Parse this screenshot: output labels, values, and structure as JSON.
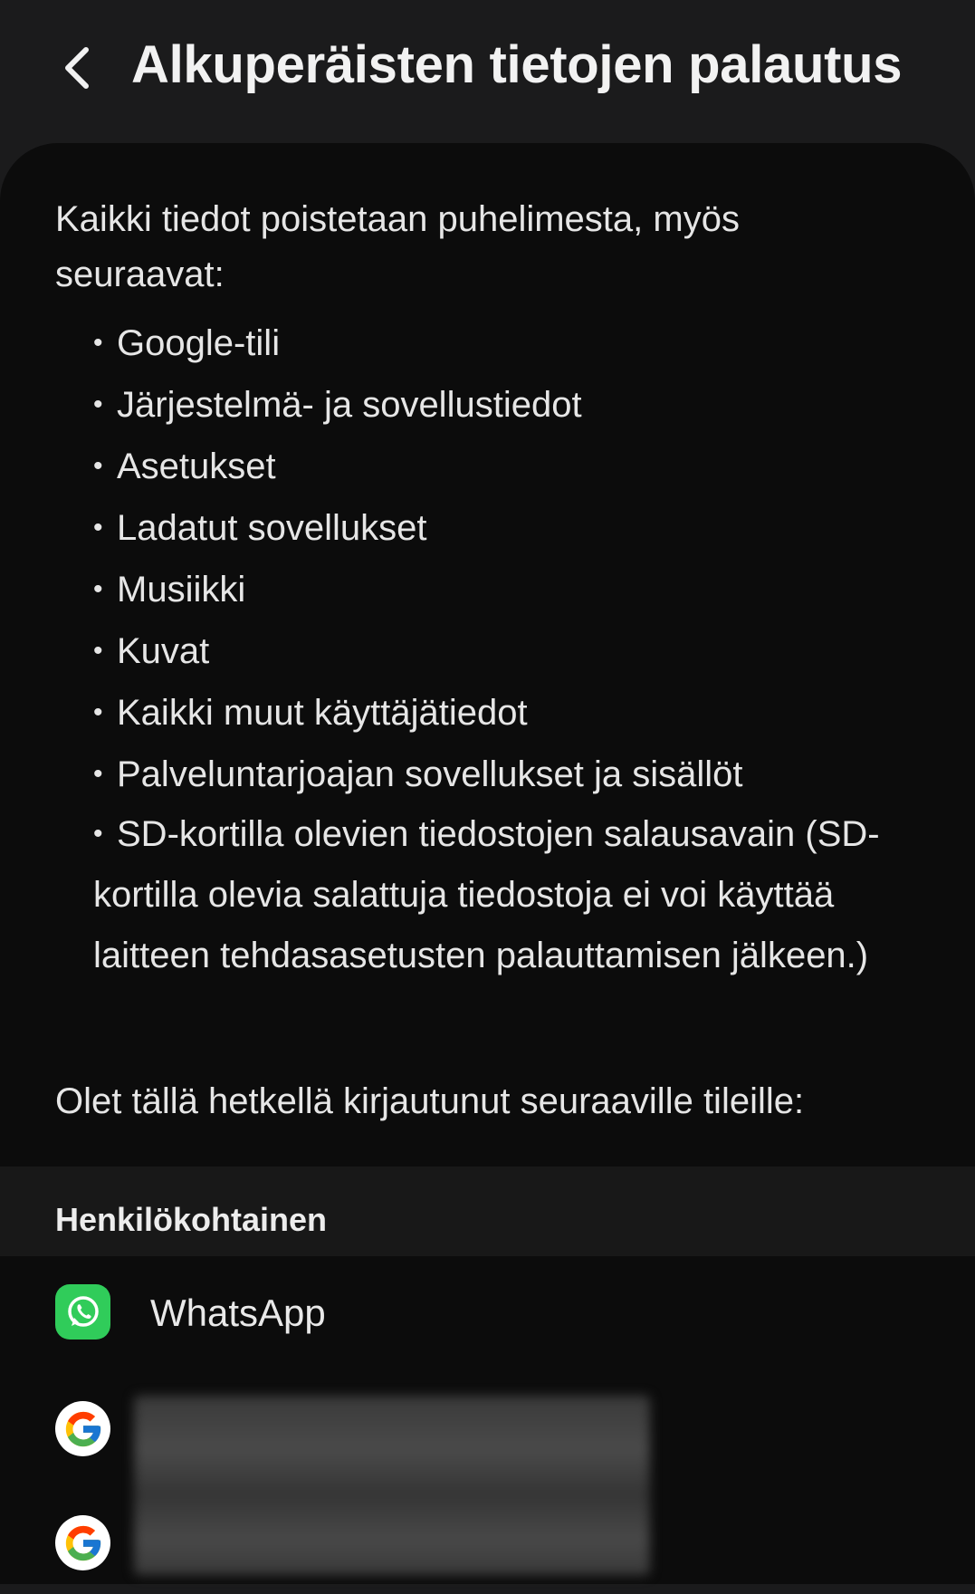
{
  "header": {
    "title": "Alkuperäisten tietojen palautus",
    "back_icon": "chevron-left-icon"
  },
  "content": {
    "intro": "Kaikki tiedot poistetaan puhelimesta, myös seuraavat:",
    "bullet_symbol": "•",
    "items": [
      "Google-tili",
      "Järjestelmä- ja sovellustiedot",
      "Asetukset",
      "Ladatut sovellukset",
      "Musiikki",
      "Kuvat",
      "Kaikki muut käyttäjätiedot",
      "Palveluntarjoajan sovellukset ja sisällöt",
      "SD-kortilla olevien tiedostojen salausavain (SD-kortilla olevia salattuja tiedostoja ei voi käyttää laitteen tehdasasetusten palauttamisen jälkeen.)"
    ],
    "signed_in_text": "Olet tällä hetkellä kirjautunut seuraaville tileille:"
  },
  "accounts": {
    "section_label": "Henkilökohtainen",
    "items": [
      {
        "name": "WhatsApp",
        "icon": "whatsapp-icon"
      },
      {
        "name": "",
        "icon": "google-icon"
      },
      {
        "name": "",
        "icon": "google-icon"
      }
    ]
  },
  "colors": {
    "header_bg": "#1b1b1c",
    "card_bg": "#0c0c0c",
    "section_bg": "#181818",
    "whatsapp_green": "#30cc5a"
  }
}
